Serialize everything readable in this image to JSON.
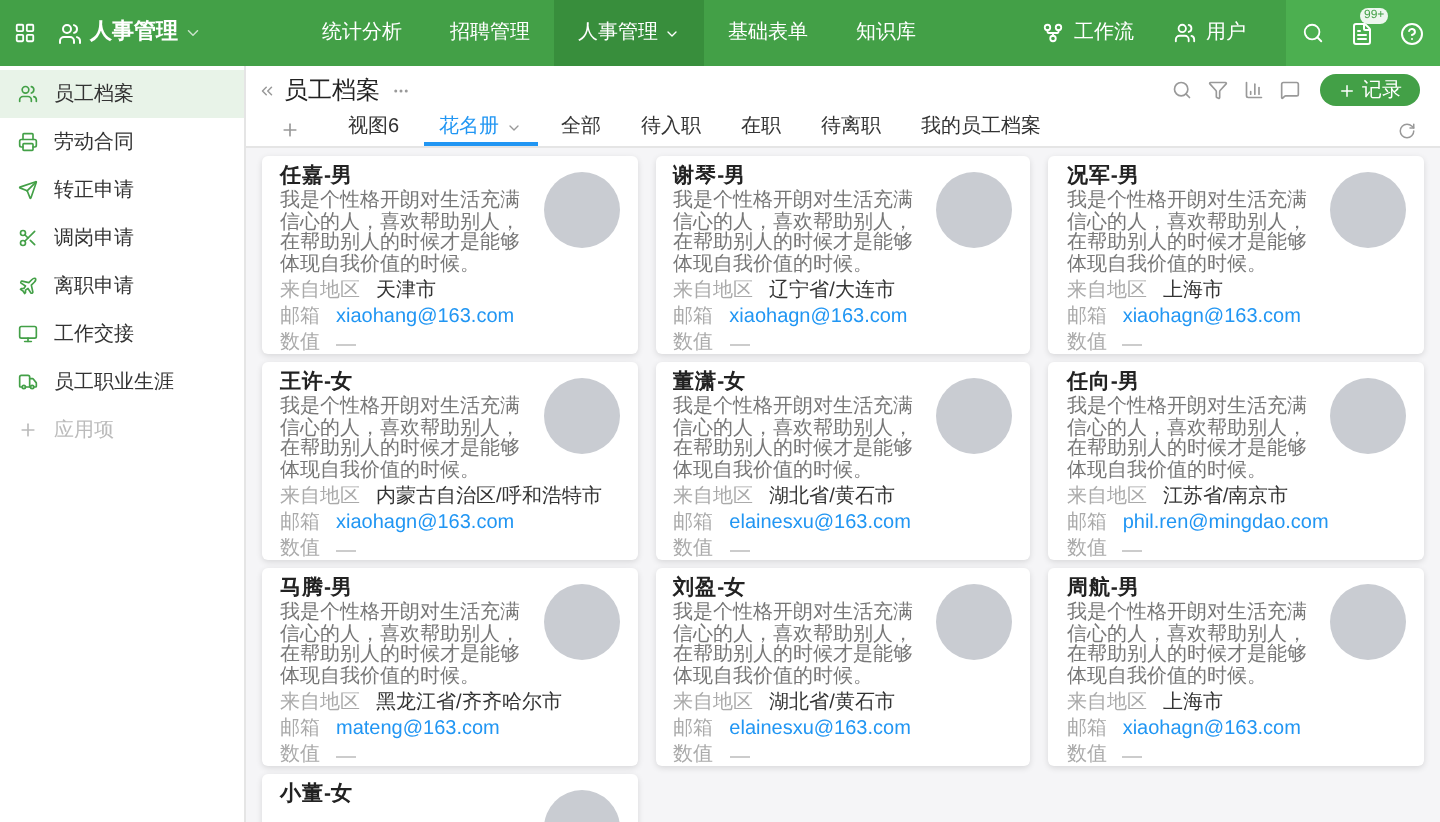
{
  "app": {
    "title": "人事管理"
  },
  "nav": [
    {
      "label": "统计分析",
      "selected": false
    },
    {
      "label": "招聘管理",
      "selected": false
    },
    {
      "label": "人事管理",
      "selected": true
    },
    {
      "label": "基础表单",
      "selected": false
    },
    {
      "label": "知识库",
      "selected": false
    }
  ],
  "top_actions": [
    {
      "label": "工作流"
    },
    {
      "label": "用户"
    }
  ],
  "notification_badge": "99+",
  "sidebar": {
    "items": [
      {
        "label": "员工档案",
        "selected": true,
        "kind": "app"
      },
      {
        "label": "劳动合同",
        "selected": false,
        "kind": "app"
      },
      {
        "label": "转正申请",
        "selected": false,
        "kind": "app"
      },
      {
        "label": "调岗申请",
        "selected": false,
        "kind": "app"
      },
      {
        "label": "离职申请",
        "selected": false,
        "kind": "app"
      },
      {
        "label": "工作交接",
        "selected": false,
        "kind": "app"
      },
      {
        "label": "员工职业生涯",
        "selected": false,
        "kind": "app"
      },
      {
        "label": "应用项",
        "selected": false,
        "kind": "add"
      }
    ]
  },
  "header": {
    "title": "员工档案",
    "add_button": "记录"
  },
  "views": [
    {
      "label": "视图6",
      "selected": false
    },
    {
      "label": "花名册",
      "selected": true
    },
    {
      "label": "全部",
      "selected": false
    },
    {
      "label": "待入职",
      "selected": false
    },
    {
      "label": "在职",
      "selected": false
    },
    {
      "label": "待离职",
      "selected": false
    },
    {
      "label": "我的员工档案",
      "selected": false
    }
  ],
  "cards": [
    {
      "name": "任嘉-男",
      "description": "我是个性格开朗对生活充满信心的人，喜欢帮助别人，在帮助别人的时候才是能够体现自我价值的时候。",
      "fields": [
        {
          "label": "来自地区",
          "value": "天津市",
          "kind": "text"
        },
        {
          "label": "邮箱",
          "value": "xiaohang@163.com",
          "kind": "email"
        },
        {
          "label": "数值",
          "kind": "empty"
        }
      ]
    },
    {
      "name": "谢琴-男",
      "description": "我是个性格开朗对生活充满信心的人，喜欢帮助别人，在帮助别人的时候才是能够体现自我价值的时候。",
      "fields": [
        {
          "label": "来自地区",
          "value": "辽宁省/大连市",
          "kind": "text"
        },
        {
          "label": "邮箱",
          "value": "xiaohagn@163.com",
          "kind": "email"
        },
        {
          "label": "数值",
          "kind": "empty"
        }
      ]
    },
    {
      "name": "况军-男",
      "description": "我是个性格开朗对生活充满信心的人，喜欢帮助别人，在帮助别人的时候才是能够体现自我价值的时候。",
      "fields": [
        {
          "label": "来自地区",
          "value": "上海市",
          "kind": "text"
        },
        {
          "label": "邮箱",
          "value": "xiaohagn@163.com",
          "kind": "email"
        },
        {
          "label": "数值",
          "kind": "empty"
        }
      ]
    },
    {
      "name": "王许-女",
      "description": "我是个性格开朗对生活充满信心的人，喜欢帮助别人，在帮助别人的时候才是能够体现自我价值的时候。",
      "fields": [
        {
          "label": "来自地区",
          "value": "内蒙古自治区/呼和浩特市",
          "kind": "text"
        },
        {
          "label": "邮箱",
          "value": "xiaohagn@163.com",
          "kind": "email"
        },
        {
          "label": "数值",
          "kind": "empty"
        }
      ]
    },
    {
      "name": "董潇-女",
      "description": "我是个性格开朗对生活充满信心的人，喜欢帮助别人，在帮助别人的时候才是能够体现自我价值的时候。",
      "fields": [
        {
          "label": "来自地区",
          "value": "湖北省/黄石市",
          "kind": "text"
        },
        {
          "label": "邮箱",
          "value": "elainesxu@163.com",
          "kind": "email"
        },
        {
          "label": "数值",
          "kind": "empty"
        }
      ]
    },
    {
      "name": "任向-男",
      "description": "我是个性格开朗对生活充满信心的人，喜欢帮助别人，在帮助别人的时候才是能够体现自我价值的时候。",
      "fields": [
        {
          "label": "来自地区",
          "value": "江苏省/南京市",
          "kind": "text"
        },
        {
          "label": "邮箱",
          "value": "phil.ren@mingdao.com",
          "kind": "email"
        },
        {
          "label": "数值",
          "kind": "empty"
        }
      ]
    },
    {
      "name": "马腾-男",
      "description": "我是个性格开朗对生活充满信心的人，喜欢帮助别人，在帮助别人的时候才是能够体现自我价值的时候。",
      "fields": [
        {
          "label": "来自地区",
          "value": "黑龙江省/齐齐哈尔市",
          "kind": "text"
        },
        {
          "label": "邮箱",
          "value": "mateng@163.com",
          "kind": "email"
        },
        {
          "label": "数值",
          "kind": "empty"
        }
      ]
    },
    {
      "name": "刘盈-女",
      "description": "我是个性格开朗对生活充满信心的人，喜欢帮助别人，在帮助别人的时候才是能够体现自我价值的时候。",
      "fields": [
        {
          "label": "来自地区",
          "value": "湖北省/黄石市",
          "kind": "text"
        },
        {
          "label": "邮箱",
          "value": "elainesxu@163.com",
          "kind": "email"
        },
        {
          "label": "数值",
          "kind": "empty"
        }
      ]
    },
    {
      "name": "周航-男",
      "description": "我是个性格开朗对生活充满信心的人，喜欢帮助别人，在帮助别人的时候才是能够体现自我价值的时候。",
      "fields": [
        {
          "label": "来自地区",
          "value": "上海市",
          "kind": "text"
        },
        {
          "label": "邮箱",
          "value": "xiaohagn@163.com",
          "kind": "email"
        },
        {
          "label": "数值",
          "kind": "empty"
        }
      ]
    },
    {
      "name": "小董-女"
    }
  ]
}
